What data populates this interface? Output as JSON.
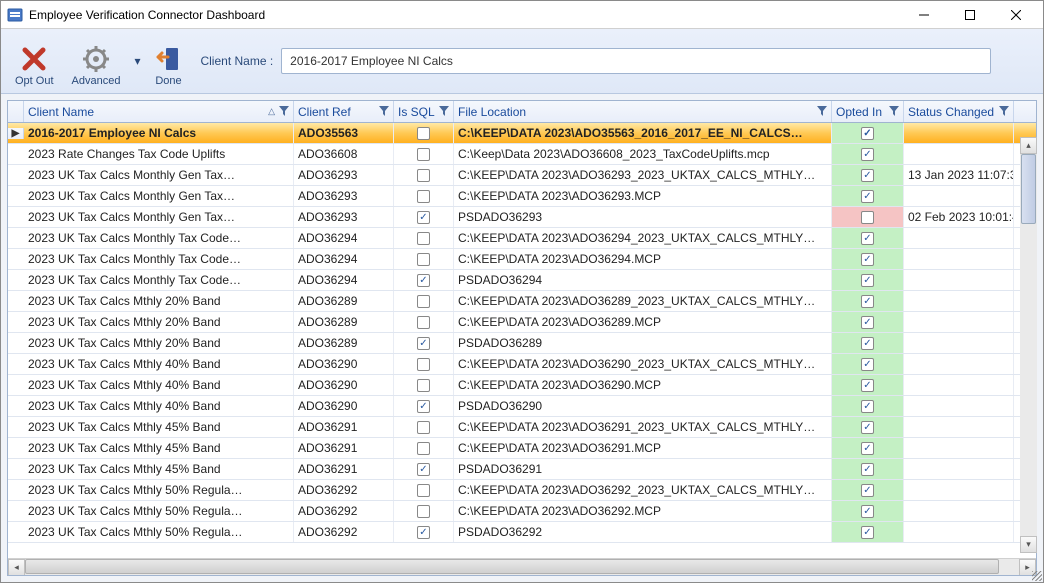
{
  "title": "Employee Verification Connector Dashboard",
  "toolbar": {
    "opt_out": "Opt Out",
    "advanced": "Advanced",
    "done": "Done",
    "client_name_label": "Client Name :",
    "client_name_value": "2016-2017 Employee NI Calcs"
  },
  "columns": {
    "client_name": "Client Name",
    "client_ref": "Client Ref",
    "is_sql": "Is SQL",
    "file_location": "File Location",
    "opted_in": "Opted In",
    "status_changed": "Status Changed"
  },
  "rows": [
    {
      "sel": true,
      "name": "2016-2017 Employee NI Calcs",
      "ref": "ADO35563",
      "sql": false,
      "loc": "C:\\KEEP\\DATA 2023\\ADO35563_2016_2017_EE_NI_CALCS…",
      "opt": true,
      "stat": ""
    },
    {
      "name": "2023 Rate Changes Tax Code Uplifts",
      "ref": "ADO36608",
      "sql": false,
      "loc": "C:\\Keep\\Data 2023\\ADO36608_2023_TaxCodeUplifts.mcp",
      "opt": true,
      "stat": ""
    },
    {
      "name": "2023 UK Tax Calcs Monthly Gen Tax…",
      "ref": "ADO36293",
      "sql": false,
      "loc": "C:\\KEEP\\DATA 2023\\ADO36293_2023_UKTAX_CALCS_MTHLY…",
      "opt": true,
      "stat": "13 Jan 2023 11:07:3"
    },
    {
      "name": "2023 UK Tax Calcs Monthly Gen Tax…",
      "ref": "ADO36293",
      "sql": false,
      "loc": "C:\\KEEP\\DATA 2023\\ADO36293.MCP",
      "opt": true,
      "stat": ""
    },
    {
      "name": "2023 UK Tax Calcs Monthly Gen Tax…",
      "ref": "ADO36293",
      "sql": true,
      "loc": "PSDADO36293",
      "opt": false,
      "stat": "02 Feb 2023 10:01:4"
    },
    {
      "name": "2023 UK Tax Calcs Monthly Tax Code…",
      "ref": "ADO36294",
      "sql": false,
      "loc": "C:\\KEEP\\DATA 2023\\ADO36294_2023_UKTAX_CALCS_MTHLY…",
      "opt": true,
      "stat": ""
    },
    {
      "name": "2023 UK Tax Calcs Monthly Tax Code…",
      "ref": "ADO36294",
      "sql": false,
      "loc": "C:\\KEEP\\DATA 2023\\ADO36294.MCP",
      "opt": true,
      "stat": ""
    },
    {
      "name": "2023 UK Tax Calcs Monthly Tax Code…",
      "ref": "ADO36294",
      "sql": true,
      "loc": "PSDADO36294",
      "opt": true,
      "stat": ""
    },
    {
      "name": "2023 UK Tax Calcs Mthly 20% Band",
      "ref": "ADO36289",
      "sql": false,
      "loc": "C:\\KEEP\\DATA 2023\\ADO36289_2023_UKTAX_CALCS_MTHLY…",
      "opt": true,
      "stat": ""
    },
    {
      "name": "2023 UK Tax Calcs Mthly 20% Band",
      "ref": "ADO36289",
      "sql": false,
      "loc": "C:\\KEEP\\DATA 2023\\ADO36289.MCP",
      "opt": true,
      "stat": ""
    },
    {
      "name": "2023 UK Tax Calcs Mthly 20% Band",
      "ref": "ADO36289",
      "sql": true,
      "loc": "PSDADO36289",
      "opt": true,
      "stat": ""
    },
    {
      "name": "2023 UK Tax Calcs Mthly 40% Band",
      "ref": "ADO36290",
      "sql": false,
      "loc": "C:\\KEEP\\DATA 2023\\ADO36290_2023_UKTAX_CALCS_MTHLY…",
      "opt": true,
      "stat": ""
    },
    {
      "name": "2023 UK Tax Calcs Mthly 40% Band",
      "ref": "ADO36290",
      "sql": false,
      "loc": "C:\\KEEP\\DATA 2023\\ADO36290.MCP",
      "opt": true,
      "stat": ""
    },
    {
      "name": "2023 UK Tax Calcs Mthly 40% Band",
      "ref": "ADO36290",
      "sql": true,
      "loc": "PSDADO36290",
      "opt": true,
      "stat": ""
    },
    {
      "name": "2023 UK Tax Calcs Mthly 45% Band",
      "ref": "ADO36291",
      "sql": false,
      "loc": "C:\\KEEP\\DATA 2023\\ADO36291_2023_UKTAX_CALCS_MTHLY…",
      "opt": true,
      "stat": ""
    },
    {
      "name": "2023 UK Tax Calcs Mthly 45% Band",
      "ref": "ADO36291",
      "sql": false,
      "loc": "C:\\KEEP\\DATA 2023\\ADO36291.MCP",
      "opt": true,
      "stat": ""
    },
    {
      "name": "2023 UK Tax Calcs Mthly 45% Band",
      "ref": "ADO36291",
      "sql": true,
      "loc": "PSDADO36291",
      "opt": true,
      "stat": ""
    },
    {
      "name": "2023 UK Tax Calcs Mthly 50% Regula…",
      "ref": "ADO36292",
      "sql": false,
      "loc": "C:\\KEEP\\DATA 2023\\ADO36292_2023_UKTAX_CALCS_MTHLY…",
      "opt": true,
      "stat": ""
    },
    {
      "name": "2023 UK Tax Calcs Mthly 50% Regula…",
      "ref": "ADO36292",
      "sql": false,
      "loc": "C:\\KEEP\\DATA 2023\\ADO36292.MCP",
      "opt": true,
      "stat": ""
    },
    {
      "name": "2023 UK Tax Calcs Mthly 50% Regula…",
      "ref": "ADO36292",
      "sql": true,
      "loc": "PSDADO36292",
      "opt": true,
      "stat": ""
    }
  ]
}
